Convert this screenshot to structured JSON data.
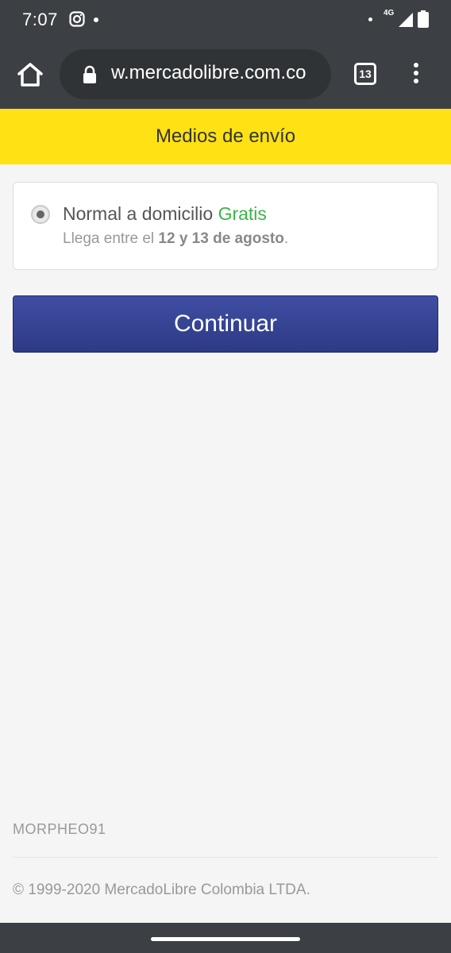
{
  "status_bar": {
    "time": "7:07",
    "network": "4G",
    "battery": "99"
  },
  "browser": {
    "url": "w.mercadolibre.com.co",
    "tab_count": "13"
  },
  "header": {
    "title": "Medios de envío"
  },
  "shipping_option": {
    "name": "Normal a domicilio",
    "price": "Gratis",
    "eta_prefix": "Llega entre el ",
    "eta_dates": "12 y 13 de agosto",
    "eta_suffix": ".",
    "selected": true
  },
  "actions": {
    "continue_label": "Continuar"
  },
  "footer": {
    "username": "MORPHEO91",
    "copyright": "© 1999-2020 MercadoLibre Colombia LTDA."
  },
  "colors": {
    "header_yellow": "#ffe114",
    "button_blue": "#3a479b",
    "price_green": "#39b54a",
    "chrome_dark": "#3c3f43"
  }
}
